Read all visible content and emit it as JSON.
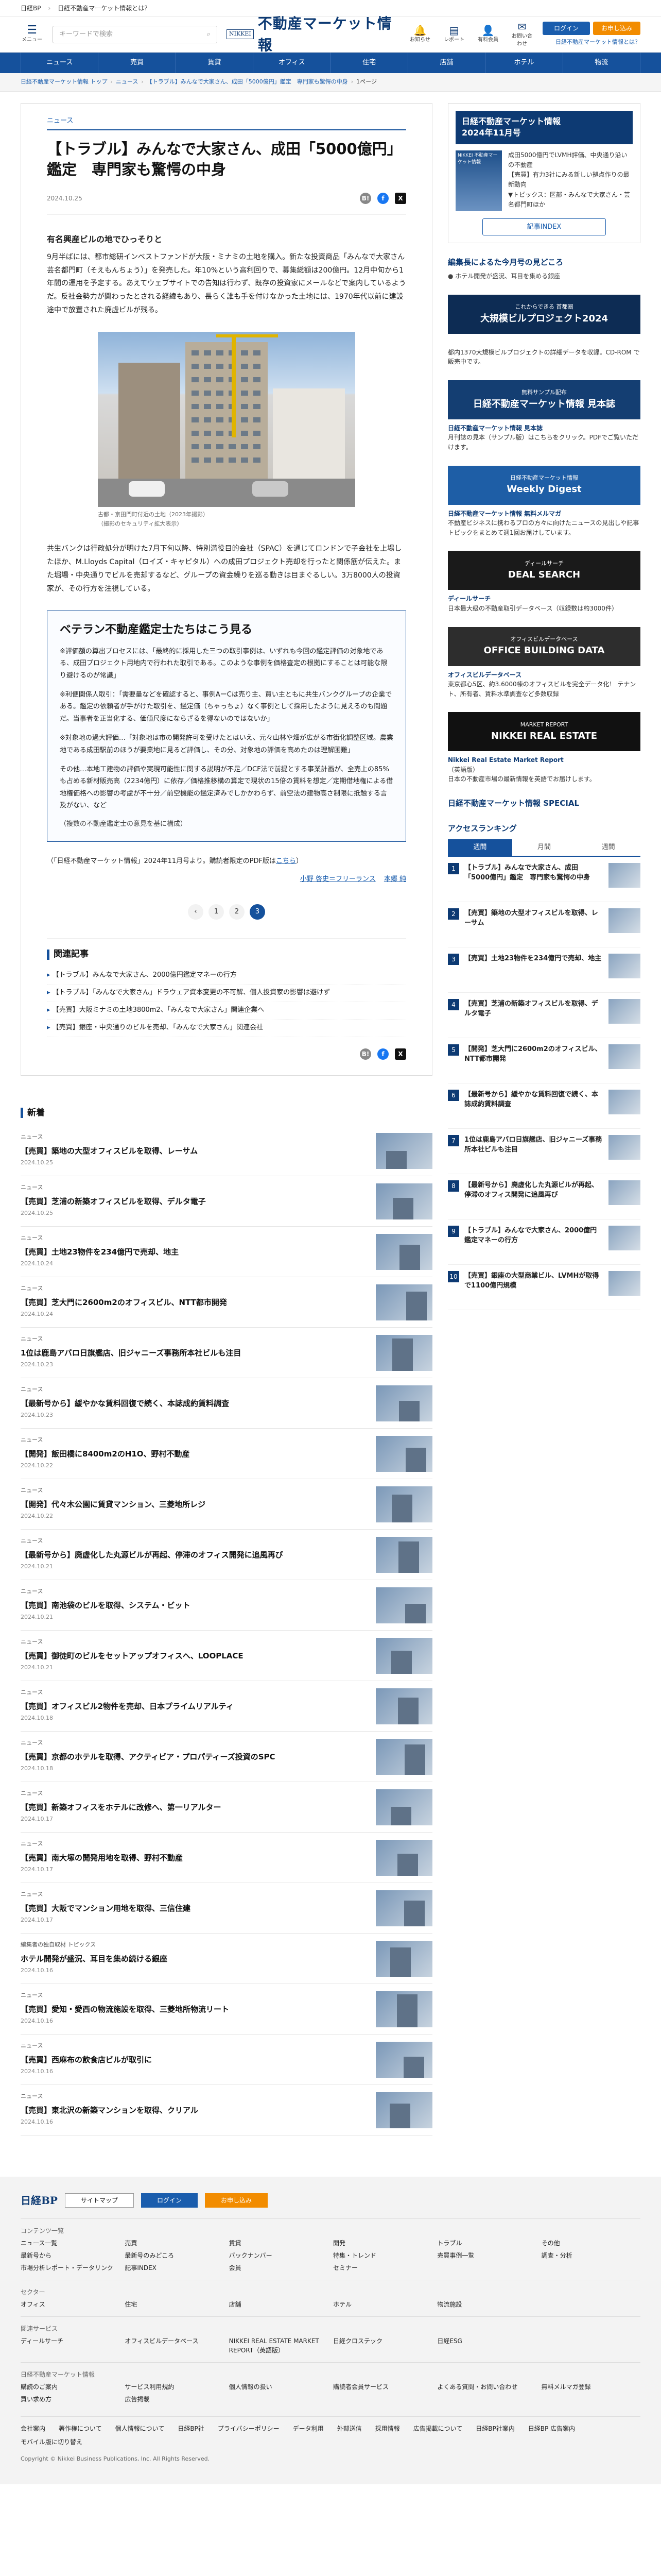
{
  "topbar": {
    "site_link": "日経BP",
    "question_link": "日経不動産マーケット情報とは？"
  },
  "header": {
    "menu_label": "メニュー",
    "search_placeholder": "キーワードで検索",
    "logo_small": "NIKKEI",
    "logo_title": "不動産マーケット情報",
    "icons": [
      {
        "label": "お知らせ",
        "icon": "bell-icon",
        "glyph": "🔔"
      },
      {
        "label": "レポート",
        "icon": "report-icon",
        "glyph": "▤"
      },
      {
        "label": "有料会員",
        "icon": "member-icon",
        "glyph": "👤"
      },
      {
        "label": "お問い合わせ",
        "icon": "mail-icon",
        "glyph": "✉"
      }
    ],
    "login": "ログイン",
    "subscribe": "お申し込み",
    "about": "日経不動産マーケット情報とは？"
  },
  "nav": [
    "ニュース",
    "売買",
    "賃貸",
    "オフィス",
    "住宅",
    "店舗",
    "ホテル",
    "物流"
  ],
  "breadcrumb": [
    "日経不動産マーケット情報 トップ",
    "ニュース",
    "【トラブル】みんなで大家さん、成田「5000億円」鑑定　専門家も驚愕の中身",
    "1ページ"
  ],
  "article": {
    "category": "ニュース",
    "title": "【トラブル】みんなで大家さん、成田「5000億円」鑑定　専門家も驚愕の中身",
    "date": "2024.10.25",
    "subhead": "有名興産ビルの地でひっそりと",
    "p1": "9月半ばには、都市総研インベストファンドが大阪・ミナミの土地を購入。新たな投資商品「みんなで大家さん芸名都門町（そえもんちょう）」を発売した。年10%という高利回りで、募集総額は200億円。12月中旬から1年間の運用を予定する。あえてウェブサイトでの告知は行わず、既存の投資家にメールなどで案内しているようだ。反社会勢力が関わったとされる経緯もあり、長らく誰も手を付けなかった土地には、1970年代以前に建設途中で放置された廃虚ビルが残る。",
    "photo_caption": "古都・京田門町付近の土地（2023年撮影）\n（撮影のセキュリティ拡大表示）",
    "p2": "共生バンクは行政処分が明けた7月下旬以降、特別満役目的会社（SPAC）を通じてロンドンで子会社を上場したほか、M.Lloyds Capital（ロイズ・キャピタル）への成田プロジェクト売却を行ったと関係筋が伝えた。また堀場・中央通りでビルを売却するなど、グループの資金繰りを巡る動きは目まぐるしい。3万8000人の投資家が、その行方を注視している。",
    "box": {
      "title": "ベテラン不動産鑑定士たちはこう見る",
      "p1": "※評価額の算出プロセスには、「最終的に採用した三つの取引事例は、いずれも今回の鑑定評価の対象地である、成田プロジェクト用地内で行われた取引である。このような事例を価格査定の根拠にすることは可能な限り避けるのが常識」",
      "p2": "※利便関係人取引：「需要量などを確認すると、事例AーCは売り主、買い主ともに共生バンクグループの企業である。鑑定の依頼者が手がけた取引を、鑑定価（ちゃっちょ）なく事例として採用したように見えるのも問題だ。当事者を正当化する、価値尺度にならざるを得ないのではないか」",
      "p3": "※対象地の過大評価…「対象地は市の開発許可を受けたとはいえ、元々山林や畑が広がる市街化調整区域。農業地である成田駅前のほうが要業地に見るど評価し、その分、対象地の評価を高めたのは理解困難」",
      "p4": "その他…本地工建物の評価や実現可能性に関する説明が不足／DCF法で前提とする事業計画が、全売上の85%も占める新材販売高（2234億円）に依存／価格推移構の算定で現状の15倍の賃料を想定／定期借地権による借地権価格への影響の考慮が不十分／前空機能の鑑定済みでしかかわらず、前空法の建物高さ制限に抵触する言及がない、など",
      "note": "（複数の不動産鑑定士の意見を基に構成）"
    },
    "pdf_pre": "（「日経不動産マーケット情報」2024年11月号より。購読者限定のPDF版は",
    "pdf_link": "こちら",
    "pdf_post": "）",
    "byline_prefix": "",
    "authors": [
      "小野 啓史＝フリーランス",
      "本郷 純"
    ],
    "pages": [
      "1",
      "2",
      "3"
    ],
    "current_page": "3"
  },
  "related": {
    "title": "関連記事",
    "items": [
      "【トラブル】みんなで大家さん、2000億円鑑定マネーの行方",
      "【トラブル】「みんなで大家さん」ドラウェア資本変更の不可解、個人投資家の影響は避けず",
      "【売買】大阪ミナミの土地3800m2、「みんなで大家さん」関連企業へ",
      "【売買】銀座・中央通りのビルを売却、「みんなで大家さん」関連会社"
    ]
  },
  "news": {
    "title": "新着",
    "items": [
      {
        "cat": "ニュース",
        "title": "【売買】築地の大型オフィスビルを取得、レーサム",
        "date": "2024.10.25"
      },
      {
        "cat": "ニュース",
        "title": "【売買】芝浦の新築オフィスビルを取得、デルタ電子",
        "date": "2024.10.25"
      },
      {
        "cat": "ニュース",
        "title": "【売買】土地23物件を234億円で売却、地主",
        "date": "2024.10.24"
      },
      {
        "cat": "ニュース",
        "title": "【売買】芝大門に2600m2のオフィスビル、NTT都市開発",
        "date": "2024.10.24"
      },
      {
        "cat": "ニュース",
        "title": "1位は鹿島アバロ日旗艦店、旧ジャニーズ事務所本社ビルも注目",
        "date": "2024.10.23"
      },
      {
        "cat": "ニュース",
        "title": "【最新号から】緩やかな賃料回復で続く、本誌成約賃料調査",
        "date": "2024.10.23"
      },
      {
        "cat": "ニュース",
        "title": "【開発】飯田橋に8400m2のH1O、野村不動産",
        "date": "2024.10.22"
      },
      {
        "cat": "ニュース",
        "title": "【開発】代々木公園に賃貸マンション、三菱地所レジ",
        "date": "2024.10.22"
      },
      {
        "cat": "ニュース",
        "title": "【最新号から】廃虚化した丸源ビルが再起、停滞のオフィス開発に追風再び",
        "date": "2024.10.21"
      },
      {
        "cat": "ニュース",
        "title": "【売買】南池袋のビルを取得、システム・ビット",
        "date": "2024.10.21"
      },
      {
        "cat": "ニュース",
        "title": "【売買】御徒町のビルをセットアップオフィスへ、LOOPLACE",
        "date": "2024.10.21"
      },
      {
        "cat": "ニュース",
        "title": "【売買】オフィスビル2物件を売却、日本プライムリアルティ",
        "date": "2024.10.18"
      },
      {
        "cat": "ニュース",
        "title": "【売買】京都のホテルを取得、アクティビア・プロパティーズ投資のSPC",
        "date": "2024.10.18"
      },
      {
        "cat": "ニュース",
        "title": "【売買】新築オフィスをホテルに改修へ、第一リアルター",
        "date": "2024.10.17"
      },
      {
        "cat": "ニュース",
        "title": "【売買】南大塚の開発用地を取得、野村不動産",
        "date": "2024.10.17"
      },
      {
        "cat": "ニュース",
        "title": "【売買】大阪でマンション用地を取得、三信住建",
        "date": "2024.10.17"
      },
      {
        "cat": "編集者の独自取材 トピックス",
        "title": "ホテル開発が盛況、耳目を集め続ける銀座",
        "date": "2024.10.16"
      },
      {
        "cat": "ニュース",
        "title": "【売買】愛知・愛西の物流施設を取得、三菱地所物流リート",
        "date": "2024.10.16"
      },
      {
        "cat": "ニュース",
        "title": "【売買】西麻布の飲食店ビルが取引に",
        "date": "2024.10.16"
      },
      {
        "cat": "ニュース",
        "title": "【売買】東北沢の新築マンションを取得、クリアル",
        "date": "2024.10.16"
      }
    ]
  },
  "sidebar": {
    "mag_head": "日経不動産マーケット情報\n2024年11月号",
    "mag_cover": "NIKKEI 不動産マーケット情報",
    "mag_text": "成田5000億円でLVMH評価、中央通り沿いの不動産\n【売買】有力3社にみる新しい拠点作りの最新動向\n▼トピックス：区部・みんなで大家さん・芸名都門町ほか",
    "idx_btn": "記事INDEX",
    "edit_head": "編集長によるた今月号の見どころ",
    "edit_text": "● ホテル開発が盛況、耳目を集める銀座",
    "banners": [
      {
        "name": "banner-cd-rom",
        "text": "大規模ビルプロジェクト2024",
        "sub": "これからできる 首都圏",
        "color": "#0d2c54",
        "cap_b": "",
        "cap": "都内1370大規模ビルプロジェクトの詳細データを収録。CD-ROM で販売中です。"
      },
      {
        "name": "banner-sample",
        "text": "日経不動産マーケット情報 見本誌",
        "sub": "無料サンプル配布",
        "color": "#143e72",
        "cap_b": "日経不動産マーケット情報 見本誌",
        "cap": "月刊誌の見本（サンプル版）はこちらをクリック。PDFでご覧いただけます。"
      },
      {
        "name": "banner-weekly",
        "text": "Weekly Digest",
        "sub": "日経不動産マーケット情報",
        "color": "#1e5ea6",
        "cap_b": "日経不動産マーケット情報 無料メルマガ",
        "cap": "不動産ビジネスに携わるプロの方々に向けたニュースの見出しや記事トピックをまとめて週1回お届けしています。"
      },
      {
        "name": "banner-deal",
        "text": "DEAL SEARCH",
        "sub": "ディールサーチ",
        "color": "#1a1a1a",
        "cap_b": "ディールサーチ",
        "cap": "日本最大級の不動産取引データベース（収録数は約3000件）"
      },
      {
        "name": "banner-office",
        "text": "OFFICE BUILDING DATA",
        "sub": "オフィスビルデータベース",
        "color": "#2d2d2d",
        "cap_b": "オフィスビルデータベース",
        "cap": "東京都心5区、約3.6000棟のオフィスビルを完全データ化！ テナント、所有者、賃料水準調査など多数収録"
      },
      {
        "name": "banner-nreal",
        "text": "NIKKEI REAL ESTATE",
        "sub": "MARKET REPORT",
        "color": "#111",
        "cap_b": "Nikkei Real Estate Market Report",
        "cap": "（英語版）\n日本の不動産市場の最新情報を英語でお届けします。"
      }
    ],
    "special": "日経不動産マーケット情報 SPECIAL",
    "ranking_title": "アクセスランキング",
    "ranking_tabs": [
      "週間",
      "月間",
      "週間"
    ],
    "ranking": [
      {
        "no": "1",
        "title": "【トラブル】みんなで大家さん、成田「5000億円」鑑定　専門家も驚愕の中身"
      },
      {
        "no": "2",
        "title": "【売買】築地の大型オフィスビルを取得、レーサム"
      },
      {
        "no": "3",
        "title": "【売買】土地23物件を234億円で売却、地主"
      },
      {
        "no": "4",
        "title": "【売買】芝浦の新築オフィスビルを取得、デルタ電子"
      },
      {
        "no": "5",
        "title": "【開発】芝大門に2600m2のオフィスビル、NTT都市開発"
      },
      {
        "no": "6",
        "title": "【最新号から】緩やかな賃料回復で続く、本誌成約賃料調査"
      },
      {
        "no": "7",
        "title": "1位は鹿島アバロ日旗艦店、旧ジャニーズ事務所本社ビルも注目"
      },
      {
        "no": "8",
        "title": "【最新号から】廃虚化した丸源ビルが再起、停滞のオフィス開発に追風再び"
      },
      {
        "no": "9",
        "title": "【トラブル】みんなで大家さん、2000億円鑑定マネーの行方"
      },
      {
        "no": "10",
        "title": "【売買】銀座の大型商業ビル、LVMHが取得で1100億円規模"
      }
    ]
  },
  "footer": {
    "logo": "日経BP",
    "sitemap": "サイトマップ",
    "login": "ログイン",
    "subscribe": "お申し込み",
    "sections": [
      {
        "head": "コンテンツ一覧",
        "links": [
          "ニュース一覧",
          "売買",
          "賃貸",
          "開発",
          "トラブル",
          "その他",
          "最新号から",
          "最新号のみどころ",
          "バックナンバー",
          "特集・トレンド",
          "売買事例一覧",
          "調査・分析",
          "市場分析レポート・データリンク",
          "記事INDEX",
          "会員",
          "セミナー"
        ]
      },
      {
        "head": "セクター",
        "links": [
          "オフィス",
          "住宅",
          "店舗",
          "ホテル",
          "物流施設"
        ]
      },
      {
        "head": "関連サービス",
        "links": [
          "ディールサーチ",
          "オフィスビルデータベース",
          "NIKKEI REAL ESTATE MARKET REPORT（英語版）",
          "日経クロステック",
          "日経ESG"
        ]
      },
      {
        "head": "日経不動産マーケット情報",
        "links": [
          "購読のご案内",
          "サービス利用規約",
          "個人情報の扱い",
          "購読者会員サービス",
          "よくある質問・お問い合わせ",
          "無料メルマガ登録",
          "買い求め方",
          "広告掲載"
        ]
      }
    ],
    "bottom_links": [
      "会社案内",
      "著作権について",
      "個人情報について",
      "日経BP社",
      "プライバシーポリシー",
      "データ利用",
      "外部送信",
      "採用情報",
      "広告掲載について",
      "日経BP社案内",
      "日経BP 広告案内",
      "モバイル版に切り替え"
    ],
    "copyright": "Copyright © Nikkei Business Publications, Inc. All Rights Reserved."
  }
}
